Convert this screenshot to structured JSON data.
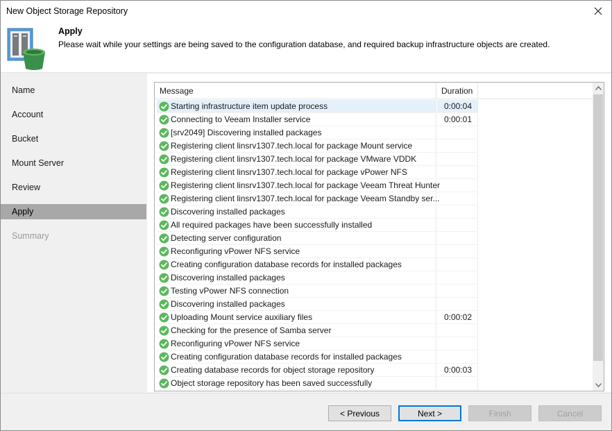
{
  "window": {
    "title": "New Object Storage Repository"
  },
  "header": {
    "title": "Apply",
    "description": "Please wait while your settings are being saved to the configuration database, and required backup infrastructure objects are created."
  },
  "sidebar": {
    "items": [
      {
        "label": "Name",
        "state": "normal"
      },
      {
        "label": "Account",
        "state": "normal"
      },
      {
        "label": "Bucket",
        "state": "normal"
      },
      {
        "label": "Mount Server",
        "state": "normal"
      },
      {
        "label": "Review",
        "state": "normal"
      },
      {
        "label": "Apply",
        "state": "active"
      },
      {
        "label": "Summary",
        "state": "disabled"
      }
    ]
  },
  "log": {
    "columns": {
      "message": "Message",
      "duration": "Duration"
    },
    "rows": [
      {
        "message": "Starting infrastructure item update process",
        "duration": "0:00:04",
        "status": "success"
      },
      {
        "message": "Connecting to Veeam Installer service",
        "duration": "0:00:01",
        "status": "success"
      },
      {
        "message": "[srv2049] Discovering installed packages",
        "duration": "",
        "status": "success"
      },
      {
        "message": "Registering client linsrv1307.tech.local for package Mount service",
        "duration": "",
        "status": "success"
      },
      {
        "message": "Registering client linsrv1307.tech.local for package VMware VDDK",
        "duration": "",
        "status": "success"
      },
      {
        "message": "Registering client linsrv1307.tech.local for package vPower NFS",
        "duration": "",
        "status": "success"
      },
      {
        "message": "Registering client linsrv1307.tech.local for package Veeam Threat Hunter",
        "duration": "",
        "status": "success"
      },
      {
        "message": "Registering client linsrv1307.tech.local for package Veeam Standby ser...",
        "duration": "",
        "status": "success"
      },
      {
        "message": "Discovering installed packages",
        "duration": "",
        "status": "success"
      },
      {
        "message": "All required packages have been successfully installed",
        "duration": "",
        "status": "success"
      },
      {
        "message": "Detecting server configuration",
        "duration": "",
        "status": "success"
      },
      {
        "message": "Reconfiguring vPower NFS service",
        "duration": "",
        "status": "success"
      },
      {
        "message": "Creating configuration database records for installed packages",
        "duration": "",
        "status": "success"
      },
      {
        "message": "Discovering installed packages",
        "duration": "",
        "status": "success"
      },
      {
        "message": "Testing vPower NFS connection",
        "duration": "",
        "status": "success"
      },
      {
        "message": "Discovering installed packages",
        "duration": "",
        "status": "success"
      },
      {
        "message": "Uploading Mount service auxiliary files",
        "duration": "0:00:02",
        "status": "success"
      },
      {
        "message": "Checking for the presence of Samba server",
        "duration": "",
        "status": "success"
      },
      {
        "message": "Reconfiguring vPower NFS service",
        "duration": "",
        "status": "success"
      },
      {
        "message": "Creating configuration database records for installed packages",
        "duration": "",
        "status": "success"
      },
      {
        "message": "Creating database records for object storage repository",
        "duration": "0:00:03",
        "status": "success"
      },
      {
        "message": "Object storage repository has been saved successfully",
        "duration": "",
        "status": "success"
      }
    ]
  },
  "footer": {
    "previous_label": "< Previous",
    "next_label": "Next >",
    "finish_label": "Finish",
    "cancel_label": "Cancel"
  },
  "colors": {
    "accent": "#0078d7",
    "success": "#5cb85c",
    "selected_row": "#e5f0fb",
    "active_nav": "#a8a8a8"
  },
  "icons": {
    "header": "repository-bucket-icon",
    "status": "check-circle-icon",
    "close": "close-icon"
  }
}
